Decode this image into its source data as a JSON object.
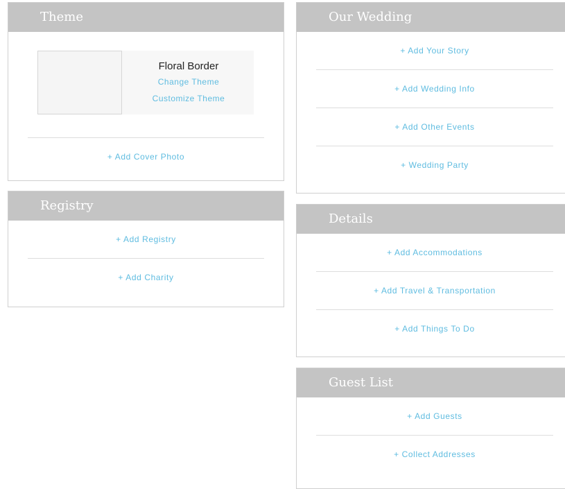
{
  "theme_panel": {
    "title": "Theme",
    "theme_name": "Floral Border",
    "change_theme": "Change Theme",
    "customize_theme": "Customize Theme",
    "add_cover_photo": "+ Add Cover Photo"
  },
  "registry_panel": {
    "title": "Registry",
    "add_registry": "+ Add Registry",
    "add_charity": "+ Add Charity"
  },
  "our_wedding_panel": {
    "title": "Our Wedding",
    "items": [
      "+ Add Your Story",
      "+ Add Wedding Info",
      "+ Add Other Events",
      "+ Wedding Party"
    ]
  },
  "details_panel": {
    "title": "Details",
    "items": [
      "+ Add Accommodations",
      "+ Add Travel & Transportation",
      "+ Add Things To Do"
    ]
  },
  "guest_list_panel": {
    "title": "Guest List",
    "items": [
      "+ Add Guests",
      "+ Collect Addresses"
    ]
  },
  "colors": {
    "header_bg": "#c4c4c4",
    "link": "#5fbce0",
    "border": "#cfcfcf"
  }
}
